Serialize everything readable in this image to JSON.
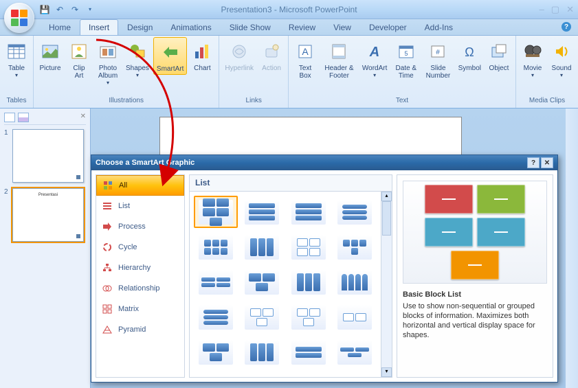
{
  "title": "Presentation3 - Microsoft PowerPoint",
  "tabs": [
    "Home",
    "Insert",
    "Design",
    "Animations",
    "Slide Show",
    "Review",
    "View",
    "Developer",
    "Add-Ins"
  ],
  "active_tab": "Insert",
  "ribbon": {
    "tables": {
      "label": "Tables",
      "items": [
        "Table"
      ]
    },
    "illustrations": {
      "label": "Illustrations",
      "items": [
        "Picture",
        "Clip Art",
        "Photo Album",
        "Shapes",
        "SmartArt",
        "Chart"
      ]
    },
    "links": {
      "label": "Links",
      "items": [
        "Hyperlink",
        "Action"
      ]
    },
    "text": {
      "label": "Text",
      "items": [
        "Text Box",
        "Header & Footer",
        "WordArt",
        "Date & Time",
        "Slide Number",
        "Symbol",
        "Object"
      ]
    },
    "media": {
      "label": "Media Clips",
      "items": [
        "Movie",
        "Sound"
      ]
    }
  },
  "slides": [
    {
      "num": "1",
      "title": ""
    },
    {
      "num": "2",
      "title": "Presentasi"
    }
  ],
  "dialog": {
    "title": "Choose a SmartArt Graphic",
    "categories": [
      "All",
      "List",
      "Process",
      "Cycle",
      "Hierarchy",
      "Relationship",
      "Matrix",
      "Pyramid"
    ],
    "selected_category": "All",
    "gallery_heading": "List",
    "preview_name": "Basic Block List",
    "preview_desc": "Use to show non-sequential or grouped blocks of information. Maximizes both horizontal and vertical display space for shapes.",
    "preview_colors": [
      "#d24b4b",
      "#8bb83b",
      "#4ca8c8",
      "#4ca8c8",
      "#f29400"
    ]
  }
}
